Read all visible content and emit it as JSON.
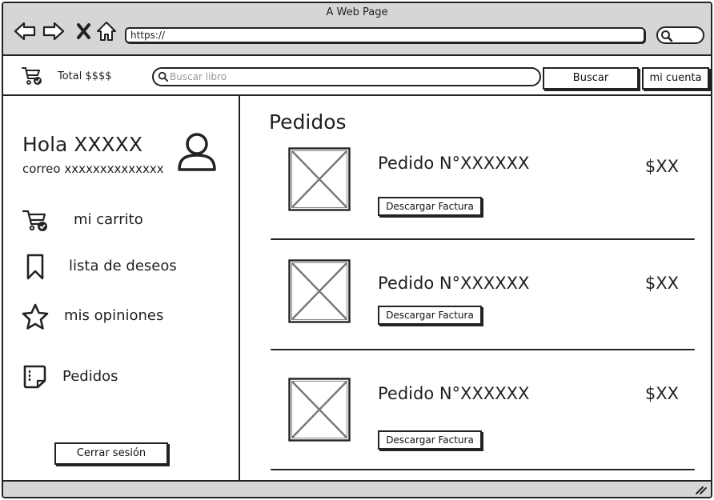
{
  "browser": {
    "title": "A Web Page",
    "url": "https://"
  },
  "icons": {
    "back": "back-arrow-icon",
    "forward": "forward-arrow-icon",
    "stop": "close-icon",
    "home": "home-icon",
    "search": "search-icon",
    "cart": "cart-icon",
    "user": "user-icon",
    "bookmark": "bookmark-icon",
    "star": "star-icon",
    "orders": "document-icon",
    "image": "image-placeholder-icon",
    "resize": "resize-grip-icon"
  },
  "header": {
    "total": "Total $$$$",
    "search_placeholder": "Buscar libro",
    "search_button": "Buscar",
    "account_button": "mi cuenta"
  },
  "sidebar": {
    "greeting": "Hola XXXXX",
    "email": "correo xxxxxxxxxxxxxx",
    "items": [
      {
        "label": "mi carrito",
        "icon": "cart-icon"
      },
      {
        "label": "lista de deseos",
        "icon": "bookmark-icon"
      },
      {
        "label": "mis opiniones",
        "icon": "star-icon"
      },
      {
        "label": "Pedidos",
        "icon": "document-icon"
      }
    ],
    "logout_button": "Cerrar sesión"
  },
  "main": {
    "title": "Pedidos",
    "orders": [
      {
        "id": "Pedido N°XXXXXX",
        "price": "$XX",
        "button": "Descargar Factura"
      },
      {
        "id": "Pedido N°XXXXXX",
        "price": "$XX",
        "button": "Descargar Factura"
      },
      {
        "id": "Pedido N°XXXXXX",
        "price": "$XX",
        "button": "Descargar Factura"
      }
    ]
  },
  "colors": {
    "chrome": "#d6d6d6",
    "ink": "#222222",
    "background": "#ffffff"
  }
}
